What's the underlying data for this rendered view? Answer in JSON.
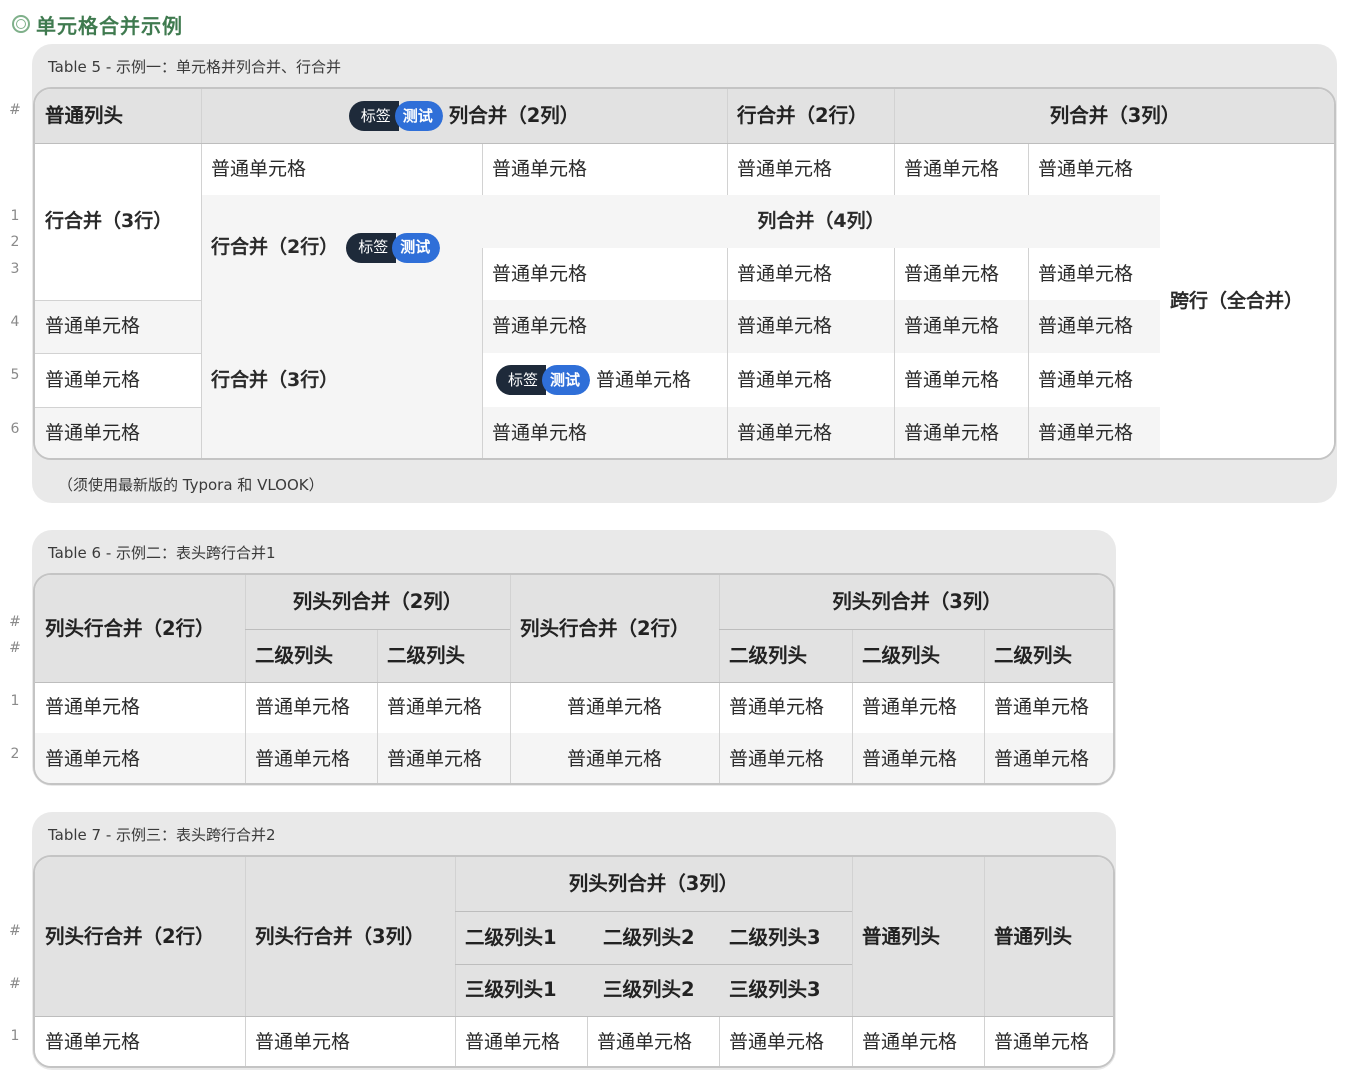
{
  "section_title": "单元格合并示例",
  "table5": {
    "caption": "Table 5 - 示例一：单元格并列合并、行合并",
    "note": "（须使用最新版的 Typora 和 VLOOK）",
    "tag": {
      "key": "标签",
      "value": "测试"
    },
    "header": {
      "c1": "普通列头",
      "c2": "列合并（2列）",
      "c3": "行合并（2行）",
      "c4": "列合并（3列）"
    },
    "row_merge_3": "行合并（3行）",
    "row_merge_2": "行合并（2行）",
    "col_merge_4": "列合并（4列）",
    "span_all": "跨行（全合并）",
    "row_merge_3b": "行合并（3行）",
    "normal": "普通单元格",
    "row_numbers": [
      "1",
      "2",
      "3",
      "4",
      "5",
      "6"
    ],
    "header_marker": "#"
  },
  "table6": {
    "caption": "Table 6 - 示例二：表头跨行合并1",
    "h_row_merge_a": "列头行合并（2行）",
    "h_col_merge_2": "列头列合并（2列）",
    "h_row_merge_b": "列头行合并（2行）",
    "h_col_merge_3": "列头列合并（3列）",
    "sub": "二级列头",
    "normal": "普通单元格",
    "row_numbers": [
      "1",
      "2"
    ],
    "header_markers": [
      "#",
      "#"
    ]
  },
  "table7": {
    "caption": "Table 7 - 示例三：表头跨行合并2",
    "h_row_merge_2": "列头行合并（2行）",
    "h_row_merge_3": "列头行合并（3列）",
    "h_col_merge_3": "列头列合并（3列）",
    "sub1": "二级列头1",
    "sub2": "二级列头2",
    "sub3": "二级列头3",
    "third1": "三级列头1",
    "third2": "三级列头2",
    "third3": "三级列头3",
    "plain_head": "普通列头",
    "normal": "普通单元格",
    "row_numbers": [
      "1"
    ],
    "header_markers": [
      "#",
      "#"
    ]
  }
}
